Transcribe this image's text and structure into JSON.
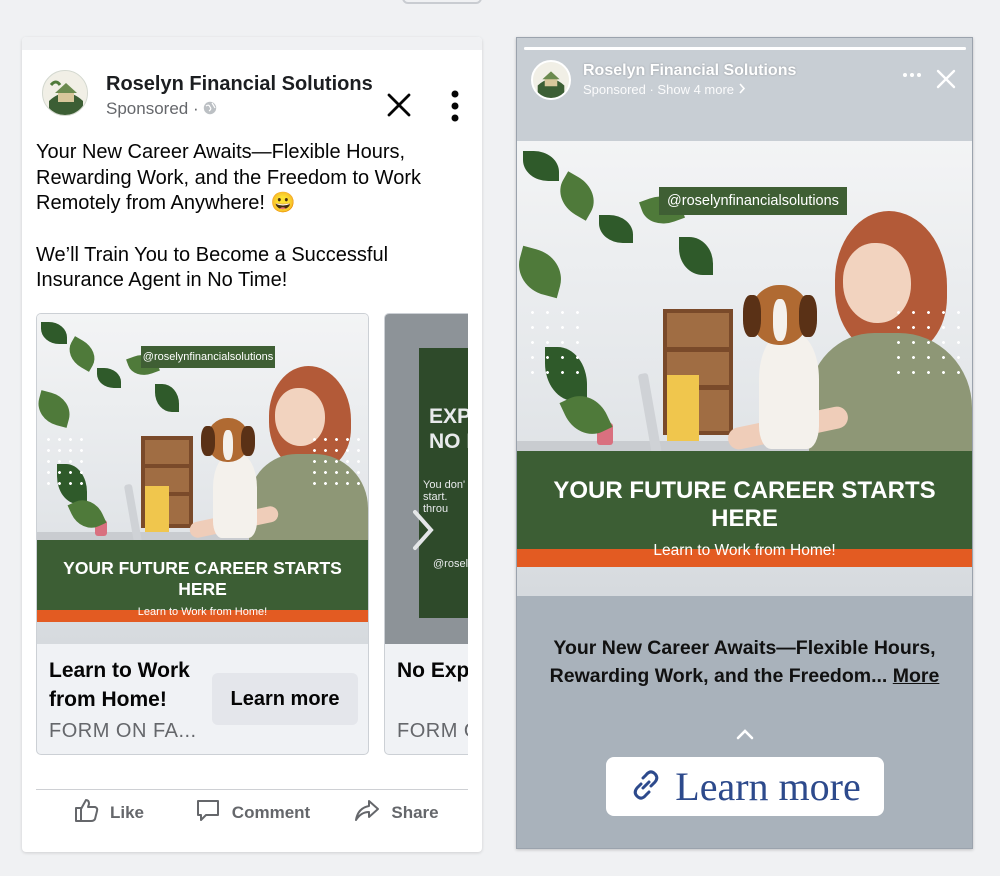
{
  "page": {
    "name": "Roselyn Financial Solutions",
    "sponsored_label": "Sponsored · ",
    "handle": "@roselynfinancialsolutions"
  },
  "feed": {
    "body_line1": "Your New Career Awaits—Flexible Hours, Rewarding Work, and the Freedom to Work Remotely from Anywhere! 😀",
    "body_line2": "We’ll Train You to Become a Successful Insurance Agent in No Time!",
    "carousel": [
      {
        "banner_title": "YOUR FUTURE CAREER STARTS HERE",
        "banner_sub": "Learn to Work from Home!",
        "title": "Learn to Work from Home!",
        "subtitle": "FORM ON FA...",
        "cta": "Learn more"
      },
      {
        "creative_title": "EXP\nNO F",
        "creative_text": "You don'\nstart.\nthrou",
        "creative_handle": "@rosel",
        "title": "No Experie",
        "subtitle": "FORM O"
      }
    ],
    "actions": {
      "like": "Like",
      "comment": "Comment",
      "share": "Share"
    }
  },
  "story": {
    "page_name": "Roselyn Financial Solutions",
    "sub_text": "Sponsored · Show 4 more",
    "progress_fraction": 1.0,
    "banner_title": "YOUR FUTURE CAREER STARTS HERE",
    "banner_sub": "Learn to Work from Home!",
    "caption": "Your New Career Awaits—Flexible Hours, Rewarding Work, and the Freedom...",
    "caption_more": "More",
    "cta": "Learn more"
  },
  "colors": {
    "brand_green": "#3c5e34",
    "cta_blue": "#2d4a8c",
    "text_secondary": "#65676b"
  },
  "icons": [
    "close-icon",
    "more-vertical-icon",
    "globe-icon",
    "like-icon",
    "comment-icon",
    "share-icon",
    "more-horizontal-icon",
    "chevron-right-icon",
    "chevron-up-icon",
    "link-icon"
  ]
}
